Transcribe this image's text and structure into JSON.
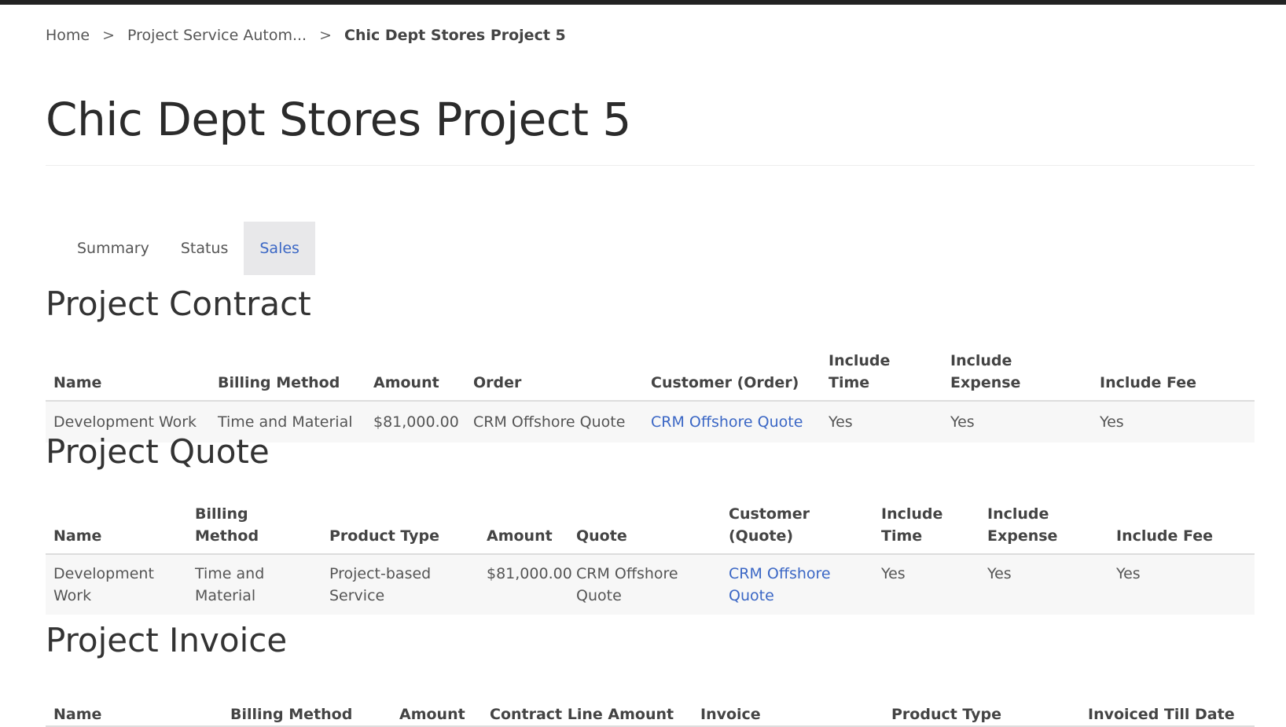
{
  "breadcrumb": {
    "items": [
      "Home",
      "Project Service Autom...",
      "Chic Dept Stores Project 5"
    ],
    "separator": ">"
  },
  "page_title": "Chic Dept Stores Project 5",
  "tabs": [
    {
      "label": "Summary",
      "active": false
    },
    {
      "label": "Status",
      "active": false
    },
    {
      "label": "Sales",
      "active": true
    }
  ],
  "contract": {
    "title": "Project Contract",
    "columns": [
      "Name",
      "Billing Method",
      "Amount",
      "Order",
      "Customer (Order)",
      "Include Time",
      "Include Expense",
      "Include Fee"
    ],
    "rows": [
      [
        "Development Work",
        "Time and Material",
        "$81,000.00",
        "CRM Offshore Quote",
        "CRM Offshore Quote",
        "Yes",
        "Yes",
        "Yes"
      ]
    ]
  },
  "quote": {
    "title": "Project Quote",
    "columns": [
      "Name",
      "Billing Method",
      "Product Type",
      "Amount",
      "Quote",
      "Customer (Quote)",
      "Include Time",
      "Include Expense",
      "Include Fee"
    ],
    "rows": [
      [
        "Development Work",
        "Time and Material",
        "Project-based Service",
        "$81,000.00",
        "CRM Offshore Quote",
        "CRM Offshore Quote",
        "Yes",
        "Yes",
        "Yes"
      ]
    ]
  },
  "invoice": {
    "title": "Project Invoice",
    "columns": [
      "Name",
      "Billing Method",
      "Amount",
      "Contract Line Amount",
      "Invoice",
      "Product Type",
      "Invoiced Till Date"
    ]
  },
  "colors": {
    "link": "#3b67c5",
    "active_tab_bg": "#e8e8ea",
    "top_bar": "#222222"
  }
}
